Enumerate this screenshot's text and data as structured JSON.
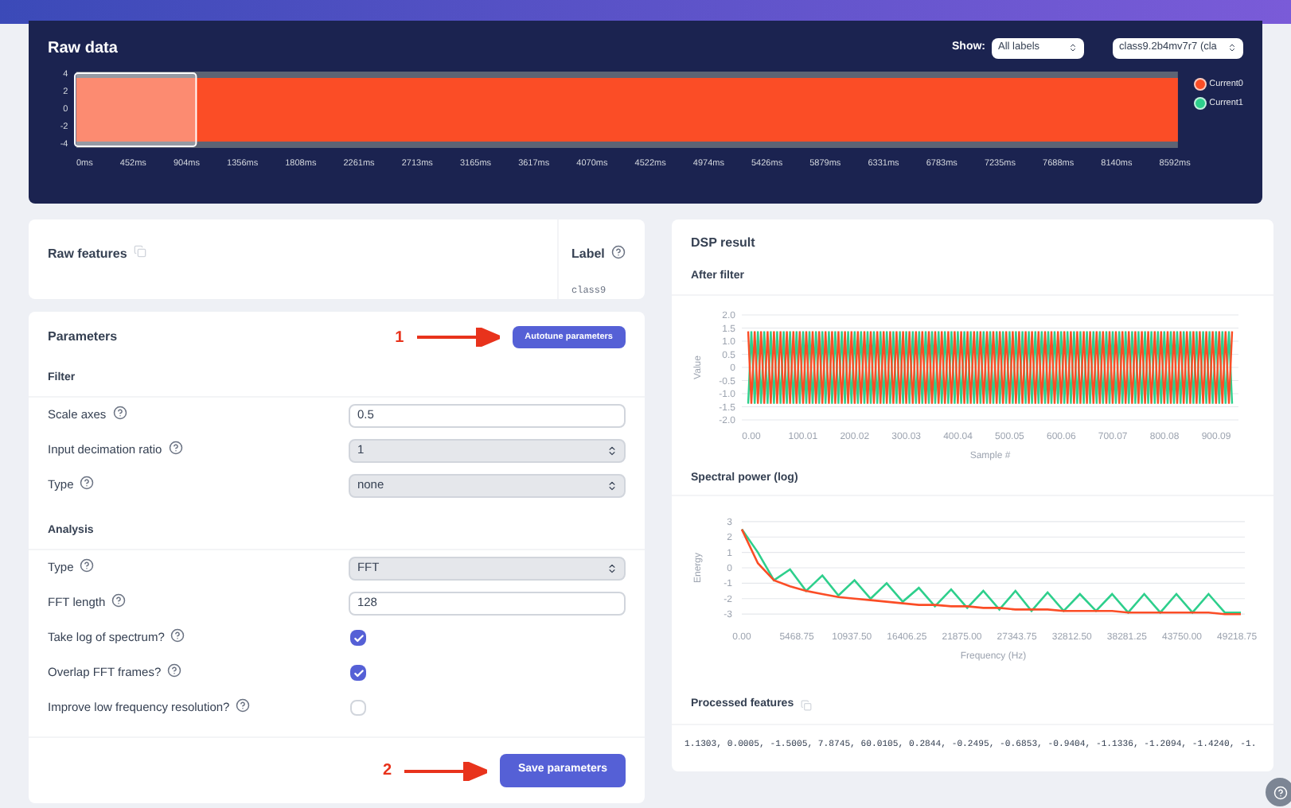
{
  "raw_data": {
    "title": "Raw data",
    "show_label": "Show:",
    "show_select": "All labels",
    "sample_select": "class9.2b4mv7r7 (cla",
    "y_ticks": [
      "4",
      "2",
      "0",
      "-2",
      "-4"
    ],
    "x_ticks": [
      "0ms",
      "452ms",
      "904ms",
      "1356ms",
      "1808ms",
      "2261ms",
      "2713ms",
      "3165ms",
      "3617ms",
      "4070ms",
      "4522ms",
      "4974ms",
      "5426ms",
      "5879ms",
      "6331ms",
      "6783ms",
      "7235ms",
      "7688ms",
      "8140ms",
      "8592ms"
    ],
    "legend": [
      {
        "name": "Current0",
        "color": "#fb4d26"
      },
      {
        "name": "Current1",
        "color": "#2ecf8c"
      }
    ]
  },
  "raw_features": {
    "title": "Raw features"
  },
  "label": {
    "title": "Label",
    "value": "class9"
  },
  "parameters": {
    "title": "Parameters",
    "autotune_marker": "1",
    "autotune_button": "Autotune parameters",
    "sections": [
      {
        "title": "Filter",
        "rows": [
          {
            "kind": "input",
            "label": "Scale axes",
            "value": "0.5"
          },
          {
            "kind": "select",
            "label": "Input decimation ratio",
            "value": "1"
          },
          {
            "kind": "select",
            "label": "Type",
            "value": "none"
          }
        ]
      },
      {
        "title": "Analysis",
        "rows": [
          {
            "kind": "select",
            "label": "Type",
            "value": "FFT"
          },
          {
            "kind": "input",
            "label": "FFT length",
            "value": "128"
          },
          {
            "kind": "checkbox",
            "label": "Take log of spectrum?",
            "checked": true
          },
          {
            "kind": "checkbox",
            "label": "Overlap FFT frames?",
            "checked": true
          },
          {
            "kind": "checkbox",
            "label": "Improve low frequency resolution?",
            "checked": false
          }
        ]
      }
    ],
    "save_marker": "2",
    "save_button": "Save parameters"
  },
  "dsp_result": {
    "title": "DSP result",
    "after_filter": {
      "title": "After filter",
      "ylabel": "Value",
      "xlabel": "Sample #",
      "yticks": [
        "2.0",
        "1.5",
        "1.0",
        "0.5",
        "0",
        "-0.5",
        "-1.0",
        "-1.5",
        "-2.0"
      ],
      "xticks": [
        "0.00",
        "100.01",
        "200.02",
        "300.03",
        "400.04",
        "500.05",
        "600.06",
        "700.07",
        "800.08",
        "900.09"
      ]
    },
    "spectral_power": {
      "title": "Spectral power (log)",
      "chart_data": {
        "type": "line",
        "xlabel": "Frequency (Hz)",
        "ylabel": "Energy",
        "x": [
          0,
          1600,
          3200,
          4800,
          6400,
          8000,
          9600,
          11200,
          12800,
          14400,
          16000,
          17600,
          19200,
          20800,
          22400,
          24000,
          25600,
          27200,
          28800,
          30400,
          32000,
          33600,
          35200,
          36800,
          38400,
          40000,
          41600,
          43200,
          44800,
          46400,
          48000,
          49600
        ],
        "grid": true,
        "series": [
          {
            "color": "#2ecf8c",
            "values": [
              2.5,
              1.0,
              -0.8,
              -0.1,
              -1.5,
              -0.5,
              -1.8,
              -0.8,
              -2.0,
              -1.0,
              -2.2,
              -1.3,
              -2.5,
              -1.4,
              -2.6,
              -1.5,
              -2.7,
              -1.5,
              -2.8,
              -1.6,
              -2.8,
              -1.7,
              -2.8,
              -1.7,
              -2.9,
              -1.7,
              -2.9,
              -1.7,
              -2.9,
              -1.7,
              -2.9,
              -2.9
            ]
          },
          {
            "color": "#fb4d26",
            "values": [
              2.5,
              0.3,
              -0.8,
              -1.2,
              -1.5,
              -1.7,
              -1.9,
              -2.0,
              -2.1,
              -2.2,
              -2.3,
              -2.4,
              -2.4,
              -2.5,
              -2.5,
              -2.6,
              -2.6,
              -2.7,
              -2.7,
              -2.7,
              -2.8,
              -2.8,
              -2.8,
              -2.8,
              -2.9,
              -2.9,
              -2.9,
              -2.9,
              -2.9,
              -2.9,
              -3.0,
              -3.0
            ]
          }
        ],
        "xlim": [
          0,
          50000
        ],
        "ylim": [
          -3.2,
          3.2
        ],
        "yticks": [
          3,
          2,
          1,
          0,
          -1,
          -2,
          -3
        ],
        "xticks": [
          {
            "value": 0,
            "label": "0.00"
          },
          {
            "value": 5468.75,
            "label": "5468.75"
          },
          {
            "value": 10937.5,
            "label": "10937.50"
          },
          {
            "value": 16406.25,
            "label": "16406.25"
          },
          {
            "value": 21875,
            "label": "21875.00"
          },
          {
            "value": 27343.75,
            "label": "27343.75"
          },
          {
            "value": 32812.5,
            "label": "32812.50"
          },
          {
            "value": 38281.25,
            "label": "38281.25"
          },
          {
            "value": 43750,
            "label": "43750.00"
          },
          {
            "value": 49218.75,
            "label": "49218.75"
          }
        ]
      }
    },
    "processed_features": {
      "title": "Processed features",
      "values": "1.1303, 0.0005, -1.5005, 7.8745, 60.0105, 0.2844, -0.2495, -0.6853, -0.9404, -1.1336, -1.2094, -1.4240, -1."
    }
  }
}
